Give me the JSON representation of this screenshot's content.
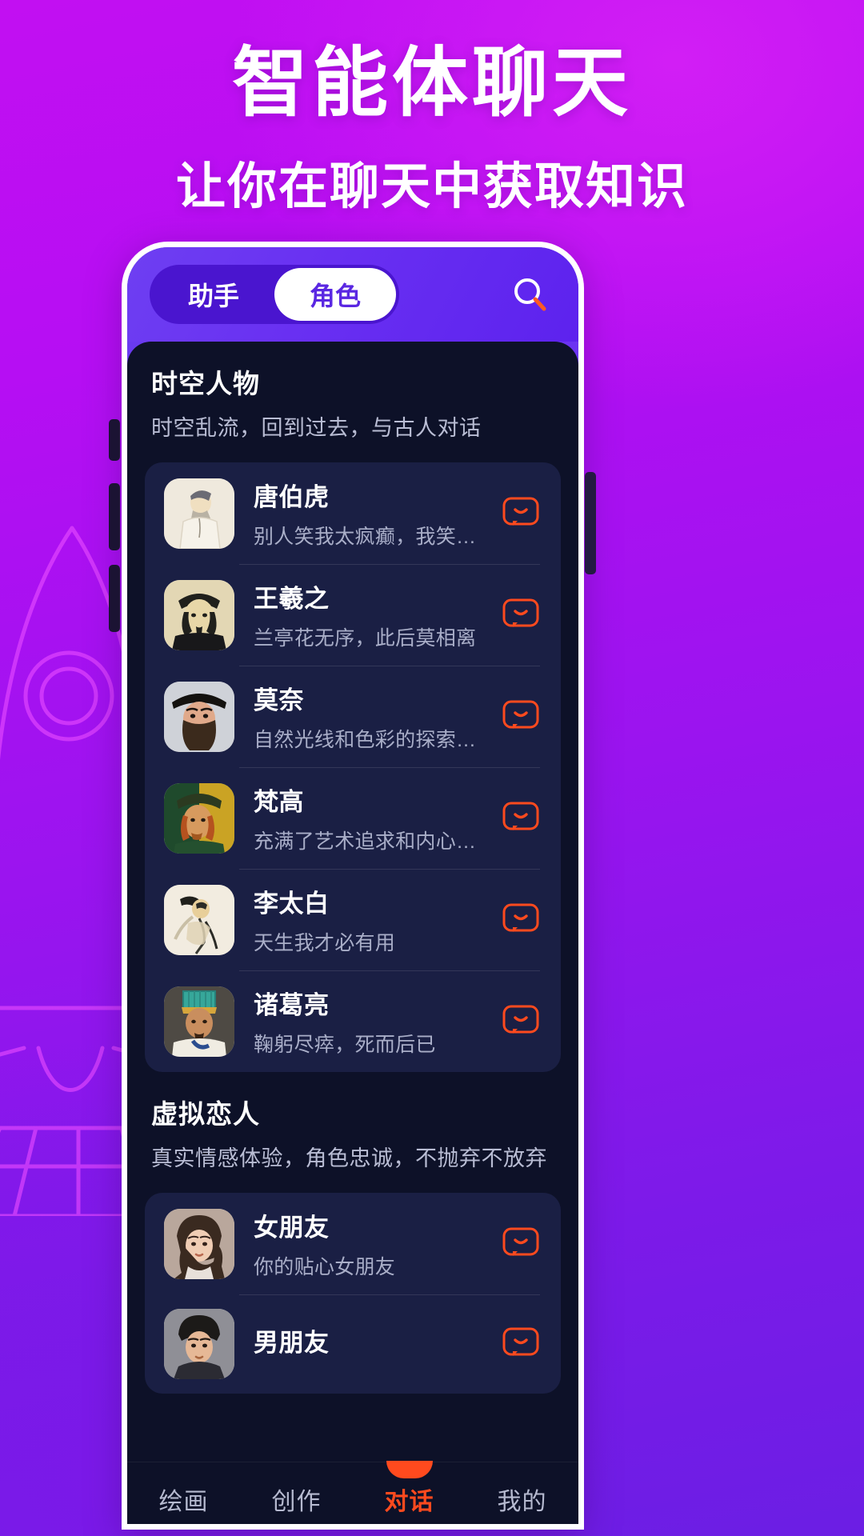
{
  "promo": {
    "headline": "智能体聊天",
    "subheadline": "让你在聊天中获取知识"
  },
  "colors": {
    "accent_orange": "#ff4a1e",
    "bg_purple": "#a70ef0",
    "panel_dark": "#0d1128",
    "card_dark": "#1a1f44",
    "tab_active_bg": "#ffffff",
    "tab_active_text": "#5a27e2"
  },
  "topbar": {
    "tabs": [
      {
        "label": "助手",
        "active": false
      },
      {
        "label": "角色",
        "active": true
      }
    ],
    "search_icon": "search-icon"
  },
  "sections": [
    {
      "title": "时空人物",
      "subtitle": "时空乱流，回到过去，与古人对话",
      "items": [
        {
          "name": "唐伯虎",
          "desc": "别人笑我太疯癫，我笑他人看不穿",
          "action_icon": "chat-bubble-icon"
        },
        {
          "name": "王羲之",
          "desc": "兰亭花无序，此后莫相离",
          "action_icon": "chat-bubble-icon"
        },
        {
          "name": "莫奈",
          "desc": "自然光线和色彩的探索大师",
          "action_icon": "chat-bubble-icon"
        },
        {
          "name": "梵高",
          "desc": "充满了艺术追求和内心的挣扎",
          "action_icon": "chat-bubble-icon"
        },
        {
          "name": "李太白",
          "desc": "天生我才必有用",
          "action_icon": "chat-bubble-icon"
        },
        {
          "name": "诸葛亮",
          "desc": "鞠躬尽瘁，死而后已",
          "action_icon": "chat-bubble-icon"
        }
      ]
    },
    {
      "title": "虚拟恋人",
      "subtitle": "真实情感体验，角色忠诚，不抛弃不放弃",
      "items": [
        {
          "name": "女朋友",
          "desc": "你的贴心女朋友",
          "action_icon": "chat-bubble-icon"
        },
        {
          "name": "男朋友",
          "desc": "",
          "action_icon": "chat-bubble-icon"
        }
      ]
    }
  ],
  "bottom_nav": [
    {
      "label": "绘画",
      "active": false
    },
    {
      "label": "创作",
      "active": false
    },
    {
      "label": "对话",
      "active": true
    },
    {
      "label": "我的",
      "active": false
    }
  ]
}
